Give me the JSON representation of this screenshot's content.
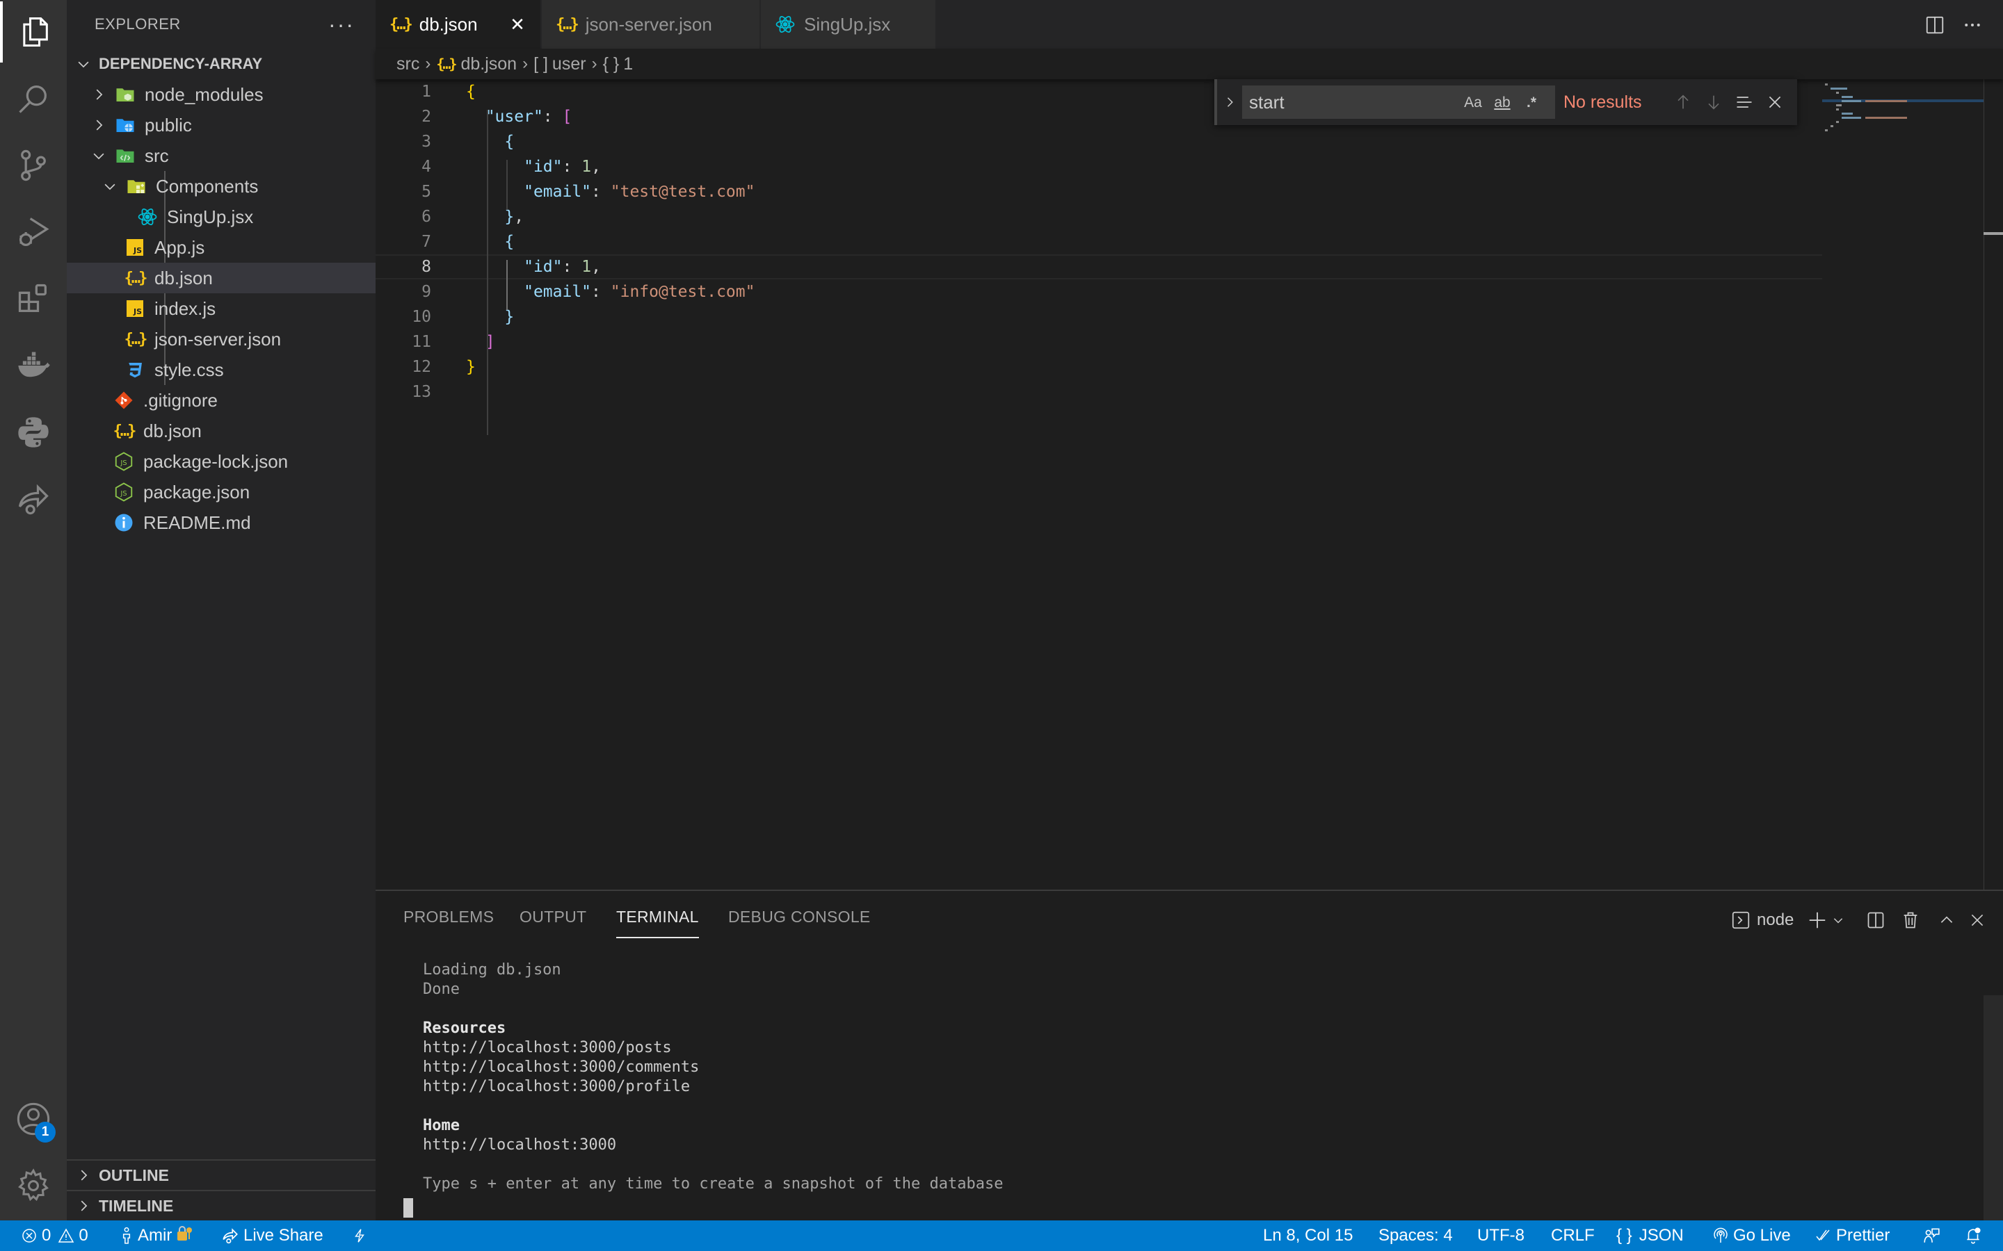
{
  "activity_bar": {
    "items": [
      {
        "name": "explorer",
        "icon": "files-icon",
        "active": true
      },
      {
        "name": "search",
        "icon": "search-icon"
      },
      {
        "name": "source-control",
        "icon": "source-control-icon"
      },
      {
        "name": "run-debug",
        "icon": "run-debug-icon"
      },
      {
        "name": "extensions",
        "icon": "extensions-icon"
      },
      {
        "name": "docker",
        "icon": "docker-icon"
      },
      {
        "name": "python",
        "icon": "python-icon"
      },
      {
        "name": "live-share",
        "icon": "live-share-icon"
      }
    ],
    "accounts_badge": "1"
  },
  "sidebar": {
    "title": "EXPLORER",
    "more_label": "···",
    "project": "DEPENDENCY-ARRAY",
    "tree": [
      {
        "label": "node_modules",
        "type": "folder",
        "expanded": false,
        "icon": "node-folder-icon"
      },
      {
        "label": "public",
        "type": "folder",
        "expanded": false,
        "icon": "public-folder-icon"
      },
      {
        "label": "src",
        "type": "folder",
        "expanded": true,
        "icon": "src-folder-icon"
      },
      {
        "label": "Components",
        "type": "folder",
        "expanded": true,
        "icon": "components-folder-icon"
      },
      {
        "label": "SingUp.jsx",
        "type": "file",
        "icon": "react-icon"
      },
      {
        "label": "App.js",
        "type": "file",
        "icon": "js-icon"
      },
      {
        "label": "db.json",
        "type": "file",
        "icon": "json-icon",
        "selected": true
      },
      {
        "label": "index.js",
        "type": "file",
        "icon": "js-icon"
      },
      {
        "label": "json-server.json",
        "type": "file",
        "icon": "json-icon"
      },
      {
        "label": "style.css",
        "type": "file",
        "icon": "css-icon"
      },
      {
        "label": ".gitignore",
        "type": "file",
        "icon": "git-icon"
      },
      {
        "label": "db.json",
        "type": "file",
        "icon": "json-icon"
      },
      {
        "label": "package-lock.json",
        "type": "file",
        "icon": "nodejs-icon"
      },
      {
        "label": "package.json",
        "type": "file",
        "icon": "nodejs-icon"
      },
      {
        "label": "README.md",
        "type": "file",
        "icon": "info-icon"
      }
    ],
    "outline": "OUTLINE",
    "timeline": "TIMELINE"
  },
  "tabs": [
    {
      "label": "db.json",
      "icon": "json-icon",
      "active": true
    },
    {
      "label": "json-server.json",
      "icon": "json-icon"
    },
    {
      "label": "SingUp.jsx",
      "icon": "react-icon"
    }
  ],
  "breadcrumb": {
    "items": [
      "src",
      "db.json",
      "user",
      "1"
    ],
    "icons": [
      "",
      "json-icon",
      "array-icon",
      "object-icon"
    ]
  },
  "editor": {
    "current_line": 8,
    "lines": [
      "{",
      "  \"user\": [",
      "    {",
      "      \"id\": 1,",
      "      \"email\": \"test@test.com\"",
      "    },",
      "    {",
      "      \"id\": 1,",
      "      \"email\": \"info@test.com\"",
      "    }",
      "  ]",
      "}",
      ""
    ]
  },
  "find_widget": {
    "query": "start",
    "match_case_label": "Aa",
    "whole_word_label": "ab",
    "regex_label": ".*",
    "status": "No results"
  },
  "panel": {
    "tabs": [
      "PROBLEMS",
      "OUTPUT",
      "TERMINAL",
      "DEBUG CONSOLE"
    ],
    "active_tab": "TERMINAL",
    "terminal_name": "node",
    "terminal_lines": [
      {
        "text": "Loading db.json",
        "style": "dim"
      },
      {
        "text": "Done",
        "style": "dim"
      },
      {
        "text": "",
        "style": ""
      },
      {
        "text": "Resources",
        "style": "bold"
      },
      {
        "text": "http://localhost:3000/posts",
        "style": ""
      },
      {
        "text": "http://localhost:3000/comments",
        "style": ""
      },
      {
        "text": "http://localhost:3000/profile",
        "style": ""
      },
      {
        "text": "",
        "style": ""
      },
      {
        "text": "Home",
        "style": "bold"
      },
      {
        "text": "http://localhost:3000",
        "style": ""
      },
      {
        "text": "",
        "style": ""
      },
      {
        "text": "Type s + enter at any time to create a snapshot of the database",
        "style": "dim"
      }
    ]
  },
  "statusbar": {
    "errors": "0",
    "warnings": "0",
    "user": "Amir",
    "live_share": "Live Share",
    "position": "Ln 8, Col 15",
    "indent": "Spaces: 4",
    "encoding": "UTF-8",
    "eol": "CRLF",
    "language": "JSON",
    "go_live": "Go Live",
    "prettier": "Prettier",
    "color": "#007acc"
  }
}
